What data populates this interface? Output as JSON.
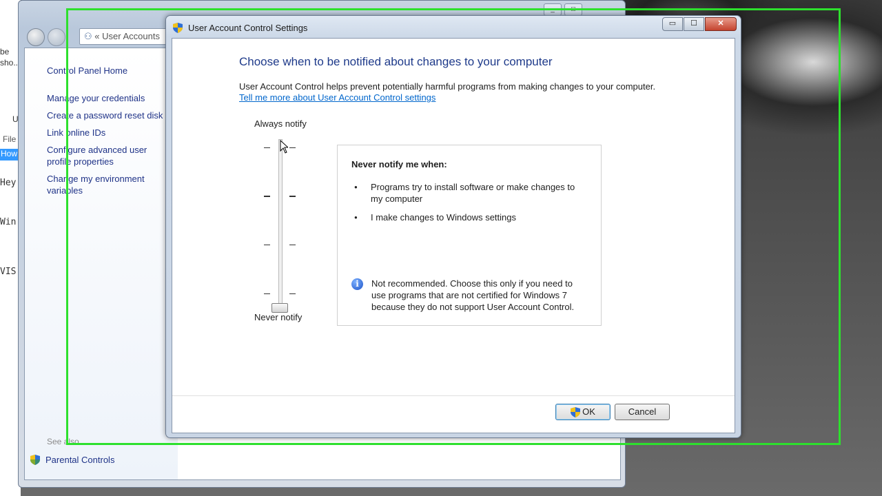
{
  "left_fragments": [
    "be",
    "sho...",
    "U",
    "File",
    "How",
    "Hey",
    "Win",
    "VIS"
  ],
  "explorer": {
    "address": "User Accounts",
    "address_chevrons": "«",
    "links": [
      "Control Panel Home",
      "Manage your credentials",
      "Create a password reset disk",
      "Link online IDs",
      "Configure advanced user profile properties",
      "Change my environment variables"
    ],
    "see_also": "See also",
    "parental_controls": "Parental Controls"
  },
  "dialog": {
    "title": "User Account Control Settings",
    "caption_buttons": {
      "minimize": "▭",
      "maximize": "☐",
      "close": "✕"
    },
    "heading": "Choose when to be notified about changes to your computer",
    "description": "User Account Control helps prevent potentially harmful programs from making changes to your computer.",
    "learn_more_link": "Tell me more about User Account Control settings",
    "slider": {
      "top_label": "Always notify",
      "bottom_label": "Never notify",
      "levels": 4,
      "selected_level": 1
    },
    "info": {
      "title": "Never notify me when:",
      "bullets": [
        "Programs try to install software or make changes to my computer",
        "I make changes to Windows settings"
      ],
      "note": "Not recommended. Choose this only if you need to use programs that are not certified for Windows 7 because they do not support User Account Control.",
      "note_icon": "info-icon"
    },
    "buttons": {
      "ok": "OK",
      "cancel": "Cancel"
    }
  },
  "colors": {
    "heading": "#1e3a8a",
    "link": "#0066cc",
    "recording_frame": "#2de02d",
    "close_button": "#c4432e"
  }
}
